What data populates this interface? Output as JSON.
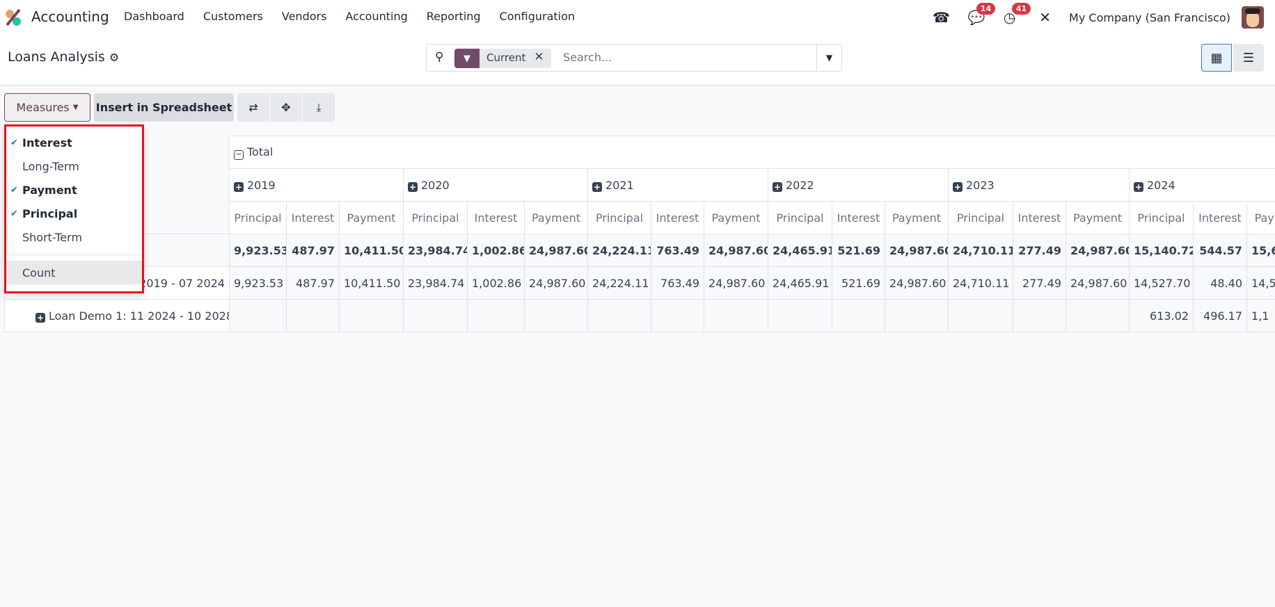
{
  "navbar": {
    "app_name": "Accounting",
    "menu": [
      "Dashboard",
      "Customers",
      "Vendors",
      "Accounting",
      "Reporting",
      "Configuration"
    ],
    "messages_badge": "14",
    "activities_badge": "41",
    "company": "My Company (San Francisco)"
  },
  "control_panel": {
    "title": "Loans Analysis",
    "search": {
      "facet": "Current",
      "placeholder": "Search..."
    }
  },
  "toolbar": {
    "measures_label": "Measures",
    "insert_label": "Insert in Spreadsheet"
  },
  "measures_dropdown": {
    "items": [
      {
        "label": "Interest",
        "checked": true
      },
      {
        "label": "Long-Term",
        "checked": false
      },
      {
        "label": "Payment",
        "checked": true
      },
      {
        "label": "Principal",
        "checked": true
      },
      {
        "label": "Short-Term",
        "checked": false
      }
    ],
    "count_label": "Count"
  },
  "pivot": {
    "total_header": "Total",
    "years": [
      "2019",
      "2020",
      "2021",
      "2022",
      "2023",
      "2024"
    ],
    "measures": [
      "Principal",
      "Interest",
      "Payment"
    ],
    "rows": [
      {
        "label": "",
        "values": [
          "9,923.53",
          "487.97",
          "10,411.50",
          "23,984.74",
          "1,002.86",
          "24,987.60",
          "24,224.11",
          "763.49",
          "24,987.60",
          "24,465.91",
          "521.69",
          "24,987.60",
          "24,710.11",
          "277.49",
          "24,987.60",
          "15,140.72",
          "544.57",
          "15,6"
        ]
      },
      {
        "label": "2019 - 07 2024",
        "values": [
          "9,923.53",
          "487.97",
          "10,411.50",
          "23,984.74",
          "1,002.86",
          "24,987.60",
          "24,224.11",
          "763.49",
          "24,987.60",
          "24,465.91",
          "521.69",
          "24,987.60",
          "24,710.11",
          "277.49",
          "24,987.60",
          "14,527.70",
          "48.40",
          "14,5"
        ]
      },
      {
        "label": "Loan Demo 1: 11 2024 - 10 2028",
        "values": [
          "",
          "",
          "",
          "",
          "",
          "",
          "",
          "",
          "",
          "",
          "",
          "",
          "",
          "",
          "",
          "613.02",
          "496.17",
          "1,1"
        ]
      }
    ]
  },
  "colors": {
    "brand": "#714b67",
    "badge": "#dc3545",
    "highlight_border": "#e8121c"
  }
}
